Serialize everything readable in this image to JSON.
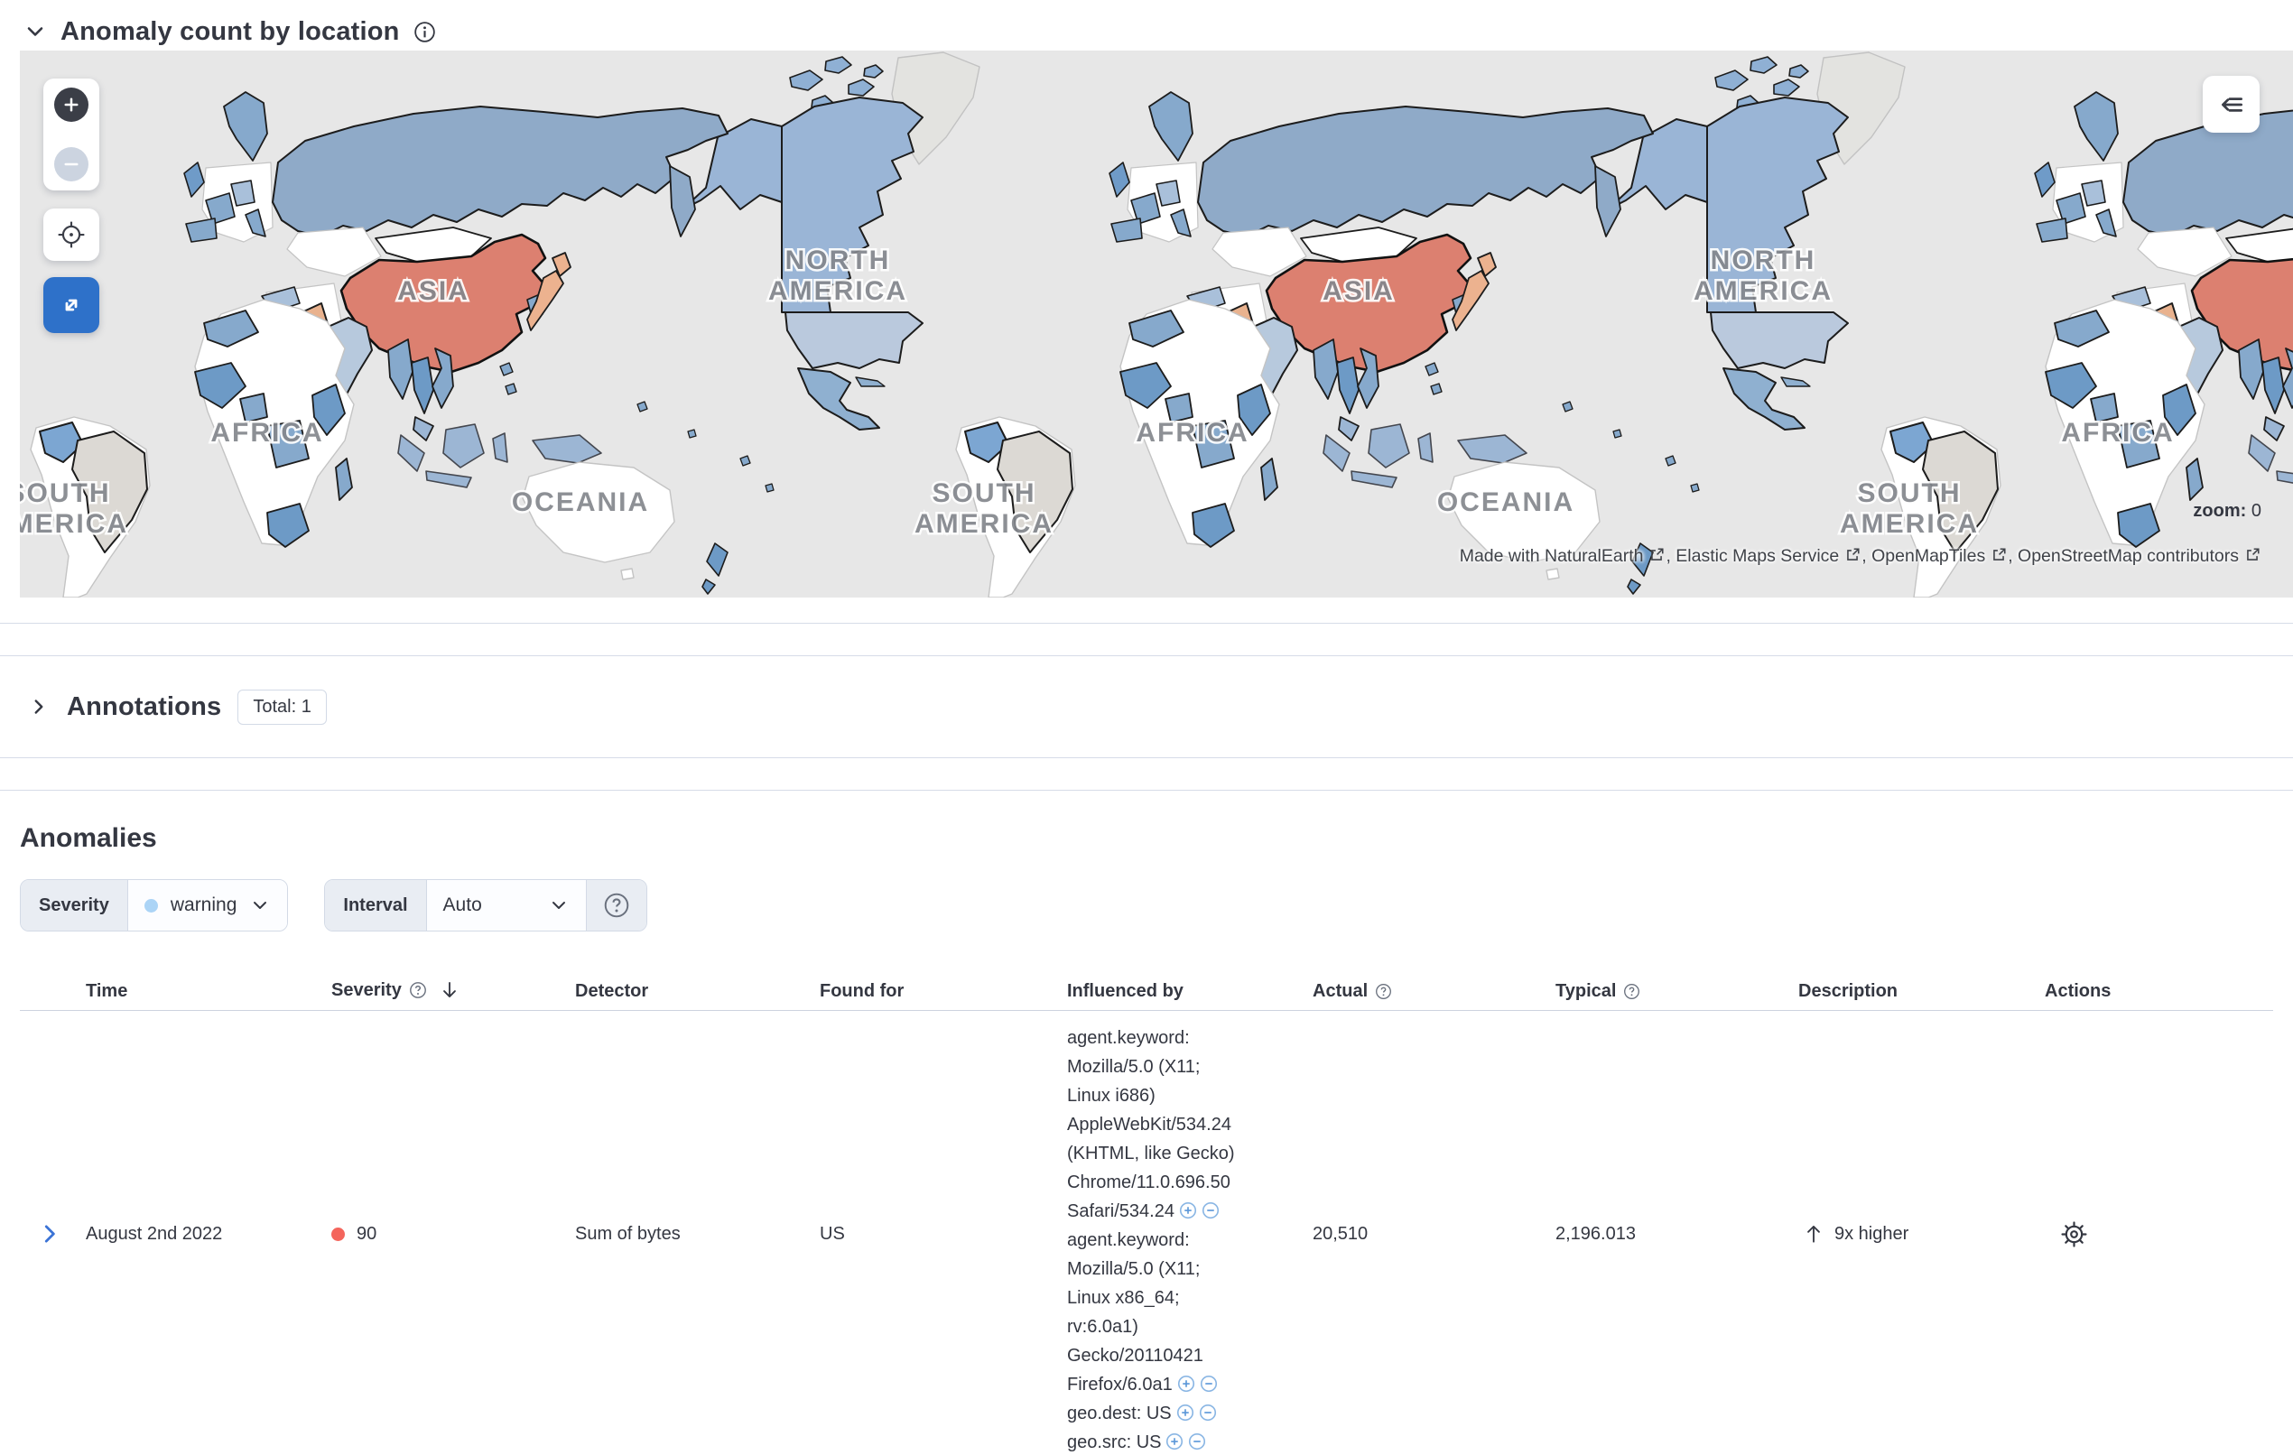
{
  "map": {
    "title": "Anomaly count by location",
    "zoom_indicator": {
      "label": "zoom:",
      "value": "0"
    },
    "attribution": {
      "part1": "Made with NaturalEarth",
      "part2": ", Elastic Maps Service",
      "part3": ", OpenMapTiles",
      "part4": ", OpenStreetMap contributors"
    },
    "labels": {
      "asia": "ASIA",
      "north_america_line1": "NORTH",
      "north_america_line2": "AMERICA",
      "africa": "AFRICA",
      "south_america_line1": "SOUTH",
      "south_america_line2": "AMERICA",
      "oceania": "OCEANIA"
    },
    "colors": {
      "ocean": "#e7e7e7",
      "country_no_data": "#ffffff",
      "country_low": "#bac9dd",
      "country_mid": "#86a9cc",
      "country_high": "#6d9ac6",
      "country_hot": "#dc8070",
      "country_warm": "#ecb28f",
      "country_excluded": "#dcd9d4"
    }
  },
  "annotations": {
    "title": "Annotations",
    "badge": "Total: 1"
  },
  "anomalies": {
    "title": "Anomalies",
    "severity_filter": {
      "label": "Severity",
      "value": "warning",
      "dot_color": "#abd4f6"
    },
    "interval_filter": {
      "label": "Interval",
      "value": "Auto"
    },
    "table": {
      "headers": {
        "time": "Time",
        "severity": "Severity",
        "detector": "Detector",
        "found_for": "Found for",
        "influenced_by": "Influenced by",
        "actual": "Actual",
        "typical": "Typical",
        "description": "Description",
        "actions": "Actions"
      },
      "row": {
        "time": "August 2nd 2022",
        "severity_value": "90",
        "severity_color": "#f4655c",
        "detector": "Sum of bytes",
        "found_for": "US",
        "influencers": [
          {
            "lines": [
              "agent.keyword:",
              "Mozilla/5.0 (X11;",
              "Linux i686)",
              "AppleWebKit/534.24",
              "(KHTML, like Gecko)",
              "Chrome/11.0.696.50",
              "Safari/534.24"
            ]
          },
          {
            "lines": [
              "agent.keyword:",
              "Mozilla/5.0 (X11;",
              "Linux x86_64;",
              "rv:6.0a1)",
              "Gecko/20110421",
              "Firefox/6.0a1"
            ]
          },
          {
            "lines": [
              "geo.dest: US"
            ]
          },
          {
            "lines": [
              "geo.src: US"
            ]
          }
        ],
        "actual": "20,510",
        "typical": "2,196.013",
        "description": "9x higher"
      }
    }
  }
}
